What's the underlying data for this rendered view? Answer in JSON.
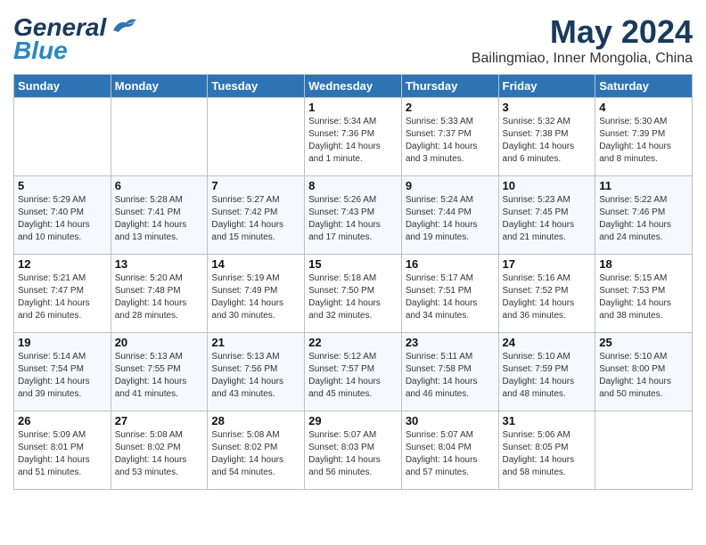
{
  "header": {
    "logo_general": "General",
    "logo_blue": "Blue",
    "month": "May 2024",
    "location": "Bailingmiao, Inner Mongolia, China"
  },
  "days_of_week": [
    "Sunday",
    "Monday",
    "Tuesday",
    "Wednesday",
    "Thursday",
    "Friday",
    "Saturday"
  ],
  "weeks": [
    [
      {
        "day": "",
        "info": ""
      },
      {
        "day": "",
        "info": ""
      },
      {
        "day": "",
        "info": ""
      },
      {
        "day": "1",
        "info": "Sunrise: 5:34 AM\nSunset: 7:36 PM\nDaylight: 14 hours\nand 1 minute."
      },
      {
        "day": "2",
        "info": "Sunrise: 5:33 AM\nSunset: 7:37 PM\nDaylight: 14 hours\nand 3 minutes."
      },
      {
        "day": "3",
        "info": "Sunrise: 5:32 AM\nSunset: 7:38 PM\nDaylight: 14 hours\nand 6 minutes."
      },
      {
        "day": "4",
        "info": "Sunrise: 5:30 AM\nSunset: 7:39 PM\nDaylight: 14 hours\nand 8 minutes."
      }
    ],
    [
      {
        "day": "5",
        "info": "Sunrise: 5:29 AM\nSunset: 7:40 PM\nDaylight: 14 hours\nand 10 minutes."
      },
      {
        "day": "6",
        "info": "Sunrise: 5:28 AM\nSunset: 7:41 PM\nDaylight: 14 hours\nand 13 minutes."
      },
      {
        "day": "7",
        "info": "Sunrise: 5:27 AM\nSunset: 7:42 PM\nDaylight: 14 hours\nand 15 minutes."
      },
      {
        "day": "8",
        "info": "Sunrise: 5:26 AM\nSunset: 7:43 PM\nDaylight: 14 hours\nand 17 minutes."
      },
      {
        "day": "9",
        "info": "Sunrise: 5:24 AM\nSunset: 7:44 PM\nDaylight: 14 hours\nand 19 minutes."
      },
      {
        "day": "10",
        "info": "Sunrise: 5:23 AM\nSunset: 7:45 PM\nDaylight: 14 hours\nand 21 minutes."
      },
      {
        "day": "11",
        "info": "Sunrise: 5:22 AM\nSunset: 7:46 PM\nDaylight: 14 hours\nand 24 minutes."
      }
    ],
    [
      {
        "day": "12",
        "info": "Sunrise: 5:21 AM\nSunset: 7:47 PM\nDaylight: 14 hours\nand 26 minutes."
      },
      {
        "day": "13",
        "info": "Sunrise: 5:20 AM\nSunset: 7:48 PM\nDaylight: 14 hours\nand 28 minutes."
      },
      {
        "day": "14",
        "info": "Sunrise: 5:19 AM\nSunset: 7:49 PM\nDaylight: 14 hours\nand 30 minutes."
      },
      {
        "day": "15",
        "info": "Sunrise: 5:18 AM\nSunset: 7:50 PM\nDaylight: 14 hours\nand 32 minutes."
      },
      {
        "day": "16",
        "info": "Sunrise: 5:17 AM\nSunset: 7:51 PM\nDaylight: 14 hours\nand 34 minutes."
      },
      {
        "day": "17",
        "info": "Sunrise: 5:16 AM\nSunset: 7:52 PM\nDaylight: 14 hours\nand 36 minutes."
      },
      {
        "day": "18",
        "info": "Sunrise: 5:15 AM\nSunset: 7:53 PM\nDaylight: 14 hours\nand 38 minutes."
      }
    ],
    [
      {
        "day": "19",
        "info": "Sunrise: 5:14 AM\nSunset: 7:54 PM\nDaylight: 14 hours\nand 39 minutes."
      },
      {
        "day": "20",
        "info": "Sunrise: 5:13 AM\nSunset: 7:55 PM\nDaylight: 14 hours\nand 41 minutes."
      },
      {
        "day": "21",
        "info": "Sunrise: 5:13 AM\nSunset: 7:56 PM\nDaylight: 14 hours\nand 43 minutes."
      },
      {
        "day": "22",
        "info": "Sunrise: 5:12 AM\nSunset: 7:57 PM\nDaylight: 14 hours\nand 45 minutes."
      },
      {
        "day": "23",
        "info": "Sunrise: 5:11 AM\nSunset: 7:58 PM\nDaylight: 14 hours\nand 46 minutes."
      },
      {
        "day": "24",
        "info": "Sunrise: 5:10 AM\nSunset: 7:59 PM\nDaylight: 14 hours\nand 48 minutes."
      },
      {
        "day": "25",
        "info": "Sunrise: 5:10 AM\nSunset: 8:00 PM\nDaylight: 14 hours\nand 50 minutes."
      }
    ],
    [
      {
        "day": "26",
        "info": "Sunrise: 5:09 AM\nSunset: 8:01 PM\nDaylight: 14 hours\nand 51 minutes."
      },
      {
        "day": "27",
        "info": "Sunrise: 5:08 AM\nSunset: 8:02 PM\nDaylight: 14 hours\nand 53 minutes."
      },
      {
        "day": "28",
        "info": "Sunrise: 5:08 AM\nSunset: 8:02 PM\nDaylight: 14 hours\nand 54 minutes."
      },
      {
        "day": "29",
        "info": "Sunrise: 5:07 AM\nSunset: 8:03 PM\nDaylight: 14 hours\nand 56 minutes."
      },
      {
        "day": "30",
        "info": "Sunrise: 5:07 AM\nSunset: 8:04 PM\nDaylight: 14 hours\nand 57 minutes."
      },
      {
        "day": "31",
        "info": "Sunrise: 5:06 AM\nSunset: 8:05 PM\nDaylight: 14 hours\nand 58 minutes."
      },
      {
        "day": "",
        "info": ""
      }
    ]
  ]
}
